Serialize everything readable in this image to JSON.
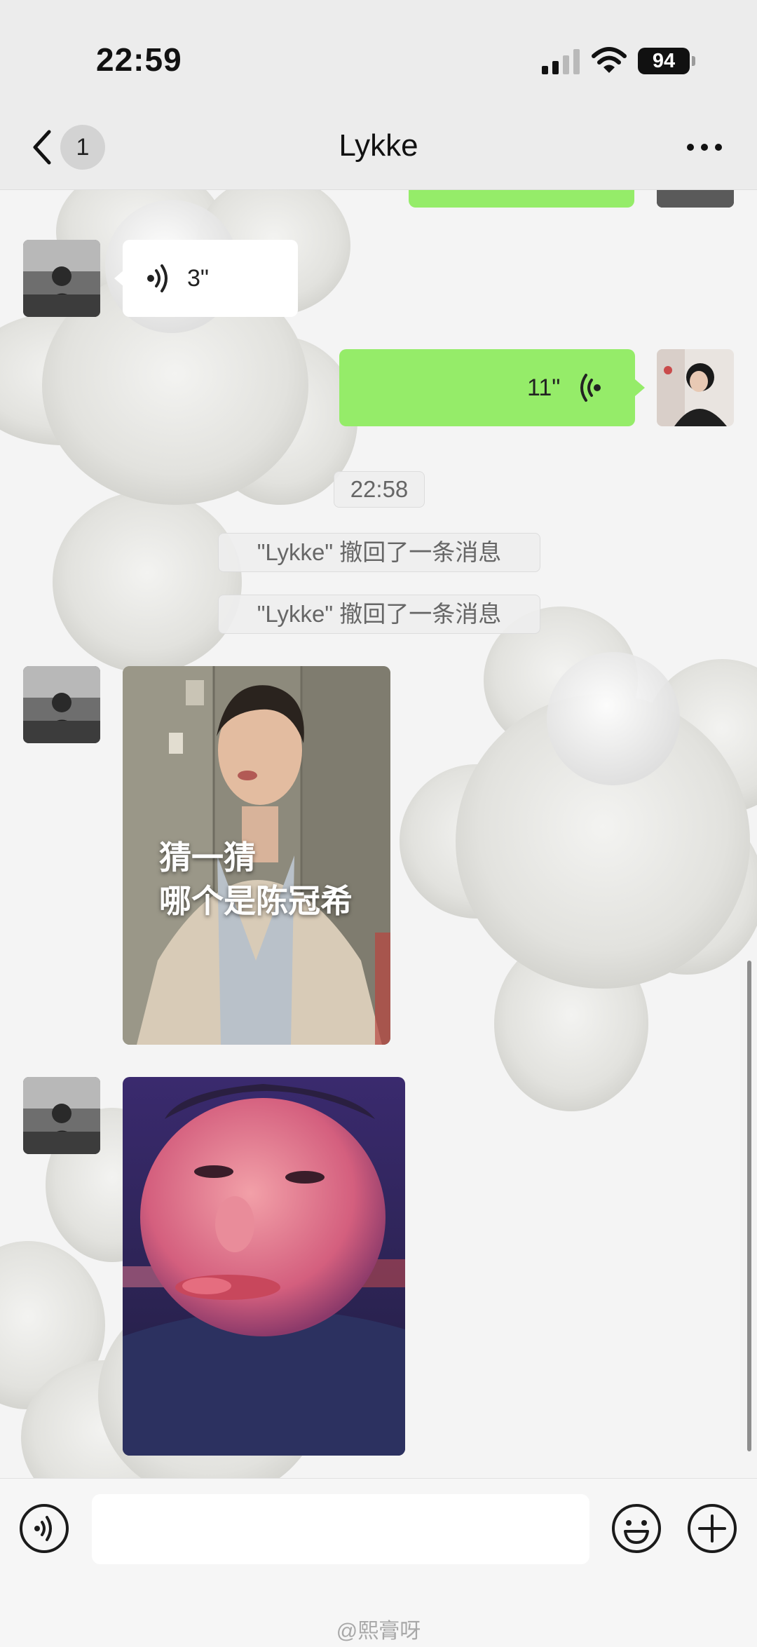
{
  "status_bar": {
    "time": "22:59",
    "battery": "94",
    "icons": [
      "cellular-signal-icon",
      "wifi-icon",
      "battery-icon"
    ]
  },
  "nav": {
    "back_icon": "chevron-left-icon",
    "unread_count": "1",
    "title": "Lykke",
    "more_icon": "more-dots-icon"
  },
  "messages": [
    {
      "kind": "outgoing-text",
      "note": "partially visible at top"
    },
    {
      "kind": "incoming-voice",
      "duration": "3\""
    },
    {
      "kind": "outgoing-voice",
      "duration": "11\""
    },
    {
      "kind": "timestamp",
      "text": "22:58"
    },
    {
      "kind": "system",
      "text": "\"Lykke\" 撤回了一条消息"
    },
    {
      "kind": "system",
      "text": "\"Lykke\" 撤回了一条消息"
    },
    {
      "kind": "incoming-image",
      "caption": "猜一猜\n哪个是陈冠希"
    },
    {
      "kind": "incoming-image"
    }
  ],
  "input": {
    "placeholder": "",
    "icons": [
      "voice-input-icon",
      "emoji-icon",
      "plus-icon"
    ]
  },
  "watermark": "@熙膏呀",
  "colors": {
    "outgoing_bubble": "#95ec69",
    "incoming_bubble": "#ffffff",
    "background": "#f4f4f4"
  }
}
